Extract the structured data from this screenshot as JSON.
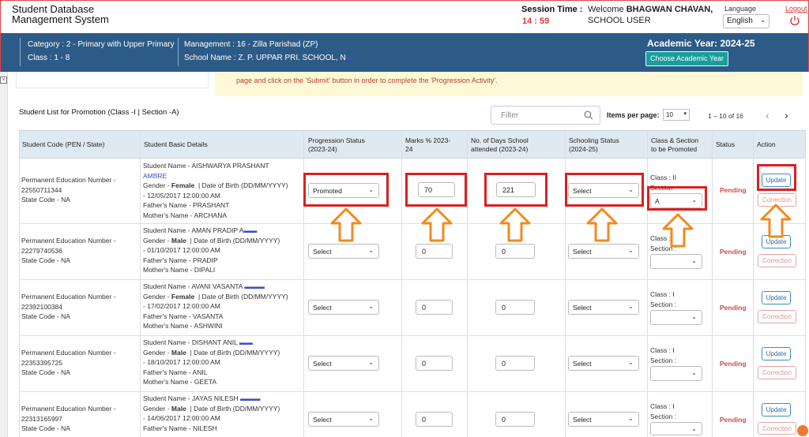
{
  "header": {
    "app_title_line1": "Student Database",
    "app_title_line2": "Management System",
    "session_label": "Session Time :",
    "session_time": "14 : 59",
    "welcome_prefix": "Welcome",
    "welcome_name": "BHAGWAN CHAVAN,",
    "user_type": "SCHOOL USER",
    "language_label": "Language",
    "language_value": "English",
    "logout": "Logout"
  },
  "info": {
    "category": "Category : 2 - Primary with Upper Primary",
    "class": "Class : 1 - 8",
    "management": "Management : 16 - Zilla Parishad (ZP)",
    "school_name": "School Name : Z. P. UPPAR PRI. SCHOOL, N",
    "academic_year": "Academic Year: 2024-25",
    "choose_button": "Choose Academic Year"
  },
  "notice": "page and click on the 'Submit' button in order to complete the 'Progression Activity'.",
  "list": {
    "title": "Student List for Promotion (Class -I | Section -A)",
    "filter_placeholder": "Filter",
    "items_per_page_label": "Items per page:",
    "items_per_page": "10",
    "range": "1 – 10 of 16"
  },
  "columns": {
    "code": "Student Code (PEN / State)",
    "details": "Student Basic Details",
    "progression_1": "Progression Status",
    "progression_2": "(2023-24)",
    "marks_1": "Marks % 2023-",
    "marks_2": "24",
    "days_1": "No. of Days School",
    "days_2": "attended (2023-24)",
    "schooling_1": "Schooling Status",
    "schooling_2": "(2024-25)",
    "class_1": "Class & Section",
    "class_2": "to be Promoted",
    "status": "Status",
    "action": "Action"
  },
  "rows": [
    {
      "pen_label": "Permanent Education Number -",
      "pen": "22550711344",
      "state_code": "State Code - NA",
      "name_prefix": "Student Name -",
      "name": "AISHWARYA PRASHANT",
      "name_cont": "AMBRE",
      "gender_prefix": "Gender -",
      "gender": "Female",
      "dob_label": "| Date of Birth (DD/MM/YYYY)",
      "dob": "- 12/05/2017 12:00:00 AM",
      "father": "Father's Name - PRASHANT",
      "mother": "Mother's Name - ARCHANA",
      "progression": "Promoted",
      "marks": "70",
      "days": "221",
      "schooling": "Select",
      "promote_class": "Class : II",
      "section_label": "Section :",
      "section": "A",
      "status": "Pending",
      "update": "Update",
      "correction": "Correction"
    },
    {
      "pen_label": "Permanent Education Number -",
      "pen": "22279740536",
      "state_code": "State Code - NA",
      "name_prefix": "Student Name -",
      "name": "AMAN PRADIP A",
      "gender_prefix": "Gender -",
      "gender": "Male",
      "dob_label": "| Date of Birth (DD/MM/YYYY)",
      "dob": "- 01/10/2017 12:00:00 AM",
      "father": "Father's Name - PRADIP",
      "mother": "Mother's Name - DIPALI",
      "progression": "Select",
      "marks": "0",
      "days": "0",
      "schooling": "Select",
      "promote_class": "Class : I",
      "section_label": "Section :",
      "section": "",
      "status": "Pending",
      "update": "Update",
      "correction": "Correction"
    },
    {
      "pen_label": "Permanent Education Number -",
      "pen": "22392100384",
      "state_code": "State Code - NA",
      "name_prefix": "Student Name -",
      "name": "AVANI VASANTA",
      "gender_prefix": "Gender -",
      "gender": "Female",
      "dob_label": "| Date of Birth (DD/MM/YYYY)",
      "dob": "- 17/02/2017 12:00:00 AM",
      "father": "Father's Name - VASANTA",
      "mother": "Mother's Name - ASHWINI",
      "progression": "Select",
      "marks": "0",
      "days": "0",
      "schooling": "Select",
      "promote_class": "Class : I",
      "section_label": "Section :",
      "section": "",
      "status": "Pending",
      "update": "Update",
      "correction": "Correction"
    },
    {
      "pen_label": "Permanent Education Number -",
      "pen": "22353395725",
      "state_code": "State Code - NA",
      "name_prefix": "Student Name -",
      "name": "DISHANT ANIL",
      "gender_prefix": "Gender -",
      "gender": "Male",
      "dob_label": "| Date of Birth (DD/MM/YYYY)",
      "dob": "- 18/10/2017 12:00:00 AM",
      "father": "Father's Name - ANIL",
      "mother": "Mother's Name - GEETA",
      "progression": "Select",
      "marks": "0",
      "days": "0",
      "schooling": "Select",
      "promote_class": "Class : I",
      "section_label": "Section :",
      "section": "",
      "status": "Pending",
      "update": "Update",
      "correction": "Correction"
    },
    {
      "pen_label": "Permanent Education Number -",
      "pen": "22313165997",
      "state_code": "State Code - NA",
      "name_prefix": "Student Name -",
      "name": "JAYAS NILESH",
      "gender_prefix": "Gender -",
      "gender": "Male",
      "dob_label": "| Date of Birth (DD/MM/YYYY)",
      "dob": "- 14/06/2017 12:00:00 AM",
      "father": "Father's Name - NILESH",
      "mother": "",
      "progression": "Select",
      "marks": "0",
      "days": "0",
      "schooling": "Select",
      "promote_class": "Class : I",
      "section_label": "Section :",
      "section": "",
      "status": "Pending",
      "update": "Update",
      "correction": "Correction"
    }
  ],
  "colors": {
    "header_blue": "#2c5b87",
    "annotation_red": "#d92020",
    "annotation_arrow": "#f08a1c",
    "pending_red": "#d24b4b",
    "update_blue": "#2a6fa8"
  }
}
